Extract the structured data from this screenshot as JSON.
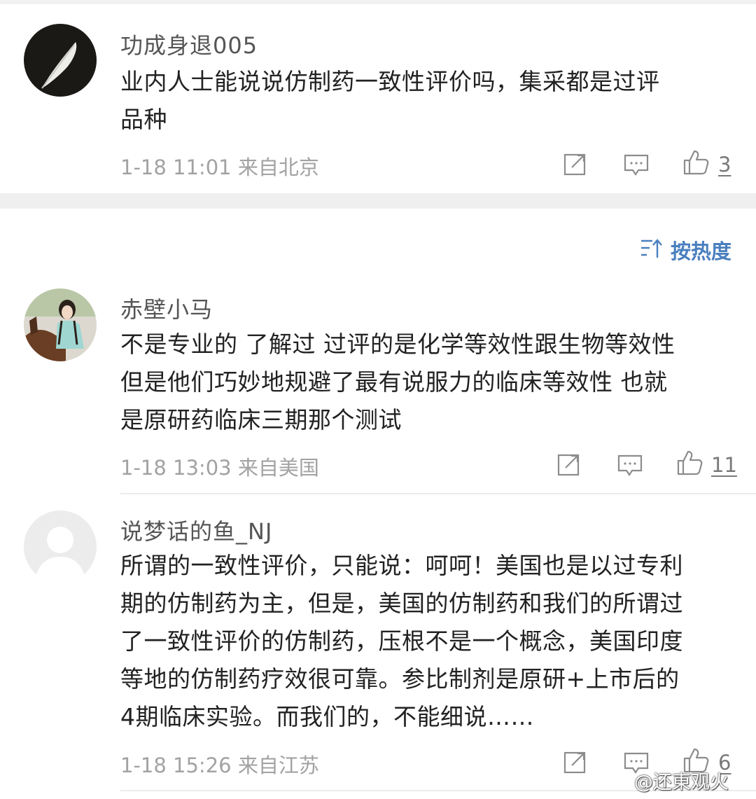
{
  "sort": {
    "label": "按热度"
  },
  "comments": [
    {
      "username": "功成身退005",
      "lines": [
        "业内人士能说说仿制药一致性评价吗，集采都是过评",
        "品种"
      ],
      "time": "1-18 11:01",
      "source": "来自北京",
      "likes": "3"
    },
    {
      "username": "赤壁小马",
      "lines": [
        "不是专业的 了解过 过评的是化学等效性跟生物等效性",
        "但是他们巧妙地规避了最有说服力的临床等效性 也就",
        "是原研药临床三期那个测试"
      ],
      "time": "1-18 13:03",
      "source": "来自美国",
      "likes": "11"
    },
    {
      "username": "说梦话的鱼_NJ",
      "lines": [
        "所谓的一致性评价，只能说：呵呵！美国也是以过专利",
        "期的仿制药为主，但是，美国的仿制药和我们的所谓过",
        "了一致性评价的仿制药，压根不是一个概念，美国印度",
        "等地的仿制药疗效很可靠。参比制剂是原研+上市后的",
        "4期临床实验。而我们的，不能细说……"
      ],
      "time": "1-18 15:26",
      "source": "来自江苏",
      "likes": "6"
    }
  ],
  "watermark": "@还東观火",
  "icons": {
    "share": "share-icon",
    "comment": "comment-icon",
    "like": "thumbs-up-icon",
    "sort": "sort-icon"
  },
  "colors": {
    "accent": "#4a7fbf",
    "meta": "#a2a2a2",
    "text": "#222222"
  }
}
